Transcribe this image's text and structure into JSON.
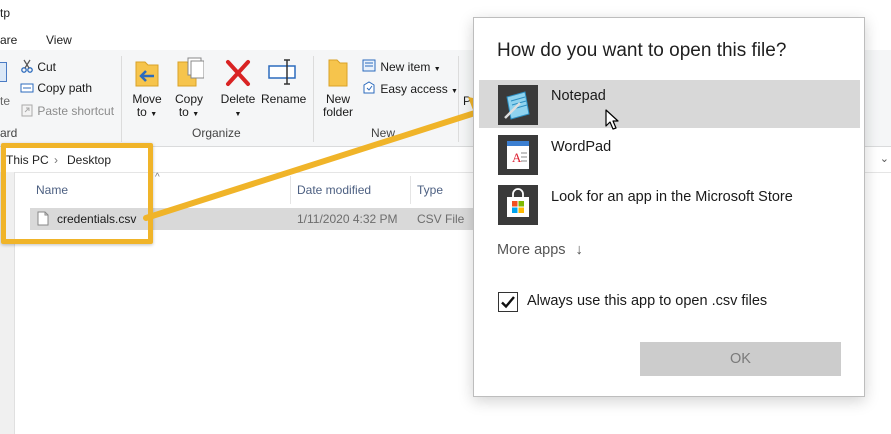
{
  "ribbon": {
    "tabs": [
      "are",
      "View"
    ],
    "top_fragment": "tp",
    "clipboard": {
      "cut": "Cut",
      "copy_path": "Copy path",
      "paste_shortcut": "Paste shortcut",
      "paste_fragment": "te",
      "group_fragment": "ard"
    },
    "organize": {
      "move_to": "Move",
      "move_to_2": "to",
      "copy_to": "Copy",
      "copy_to_2": "to",
      "delete": "Delete",
      "rename": "Rename",
      "label": "Organize"
    },
    "new": {
      "new_folder": "New",
      "new_folder_2": "folder",
      "new_item": "New item",
      "easy_access": "Easy access",
      "label": "New"
    },
    "open_fragment": "Pr"
  },
  "address": {
    "crumbs": [
      "This PC",
      "Desktop"
    ],
    "separator": "›"
  },
  "file_list": {
    "columns": [
      "Name",
      "Date modified",
      "Type"
    ],
    "rows": [
      {
        "name": "credentials.csv",
        "date": "1/11/2020 4:32 PM",
        "type": "CSV File"
      }
    ]
  },
  "dialog": {
    "title": "How do you want to open this file?",
    "apps": [
      {
        "name": "Notepad",
        "icon": "notepad-icon",
        "selected": true
      },
      {
        "name": "WordPad",
        "icon": "wordpad-icon",
        "selected": false
      },
      {
        "name": "Look for an app in the Microsoft Store",
        "icon": "store-icon",
        "selected": false
      }
    ],
    "more_apps": "More apps",
    "more_apps_glyph": "↓",
    "always_use": "Always use this app to open .csv files",
    "always_checked": true,
    "ok": "OK"
  },
  "colors": {
    "highlight": "#f0b429",
    "selected_row": "#d8d8d8"
  }
}
